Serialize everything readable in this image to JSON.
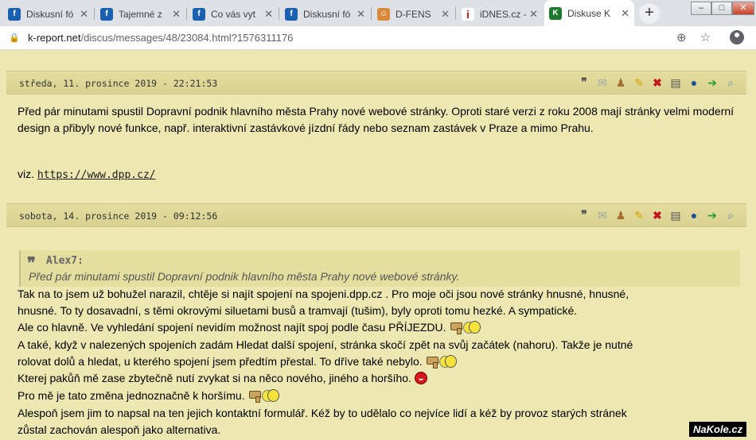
{
  "browser": {
    "tabs": [
      {
        "title": "Diskusní fó",
        "favicon": "forum-icon"
      },
      {
        "title": "Tajemné z",
        "favicon": "forum-icon"
      },
      {
        "title": "Co vás vyt",
        "favicon": "forum-icon"
      },
      {
        "title": "Diskusní fó",
        "favicon": "forum-icon"
      },
      {
        "title": "D-FENS",
        "favicon": "dfens-icon"
      },
      {
        "title": "iDNES.cz -",
        "favicon": "idnes-icon"
      },
      {
        "title": "Diskuse K",
        "favicon": "kreport-icon"
      }
    ],
    "url_domain": "k-report.net",
    "url_path": "/discus/messages/48/23084.html?1576311176"
  },
  "posts": [
    {
      "date": "středa, 11. prosince 2019 - 22:21:53",
      "text": "Před pár minutami spustil Dopravní podnik hlavního města Prahy nové webové stránky. Oproti staré verzi z roku 2008 mají stránky velmi moderní design a přibyly nové funkce, např. interaktivní zastávkové jízdní řády nebo seznam zastávek v Praze a mimo Prahu.",
      "link_prefix": "viz. ",
      "link": "https://www.dpp.cz/"
    },
    {
      "date": "sobota, 14. prosince 2019 - 09:12:56",
      "quote_author": "Alex7:",
      "quote_text": "Před pár minutami spustil Dopravní podnik hlavního města Prahy nové webové stránky.",
      "lines": [
        "Tak na to jsem už bohužel narazil, chtěje si najít spojení na spojeni.dpp.cz . Pro moje oči jsou nové stránky hnusné, hnusné,",
        "hnusné. To ty dosavadní, s těmi okrovými siluetami busů a tramvají (tušim), byly oproti tomu hezké. A sympatické.",
        "Ale co hlavně. Ve vyhledání spojení nevidím možnost najít spoj podle času PŘÍJEZDU.",
        "A také, když v nalezených spojeních zadám Hledat další spojení, stránka skočí zpět na svůj začátek (nahoru). Takže je nutné",
        "rolovat dolů a hledat, u kterého spojení jsem předtím přestal. To dříve také nebylo.",
        "Kterej pakůň mě zase zbytečně nutí zvykat si na něco nového, jiného a horšího.",
        "Pro mě je tato změna jednoznačně k horšímu.",
        "Alespoň jsem jim to napsal na ten jejich kontaktní formulář. Kéž by to udělalo co nejvíce lidí a kéž by provoz starých stránek",
        "zůstal zachován alespoň jako alternativa."
      ]
    }
  ],
  "watermark": "NaKole.cz"
}
